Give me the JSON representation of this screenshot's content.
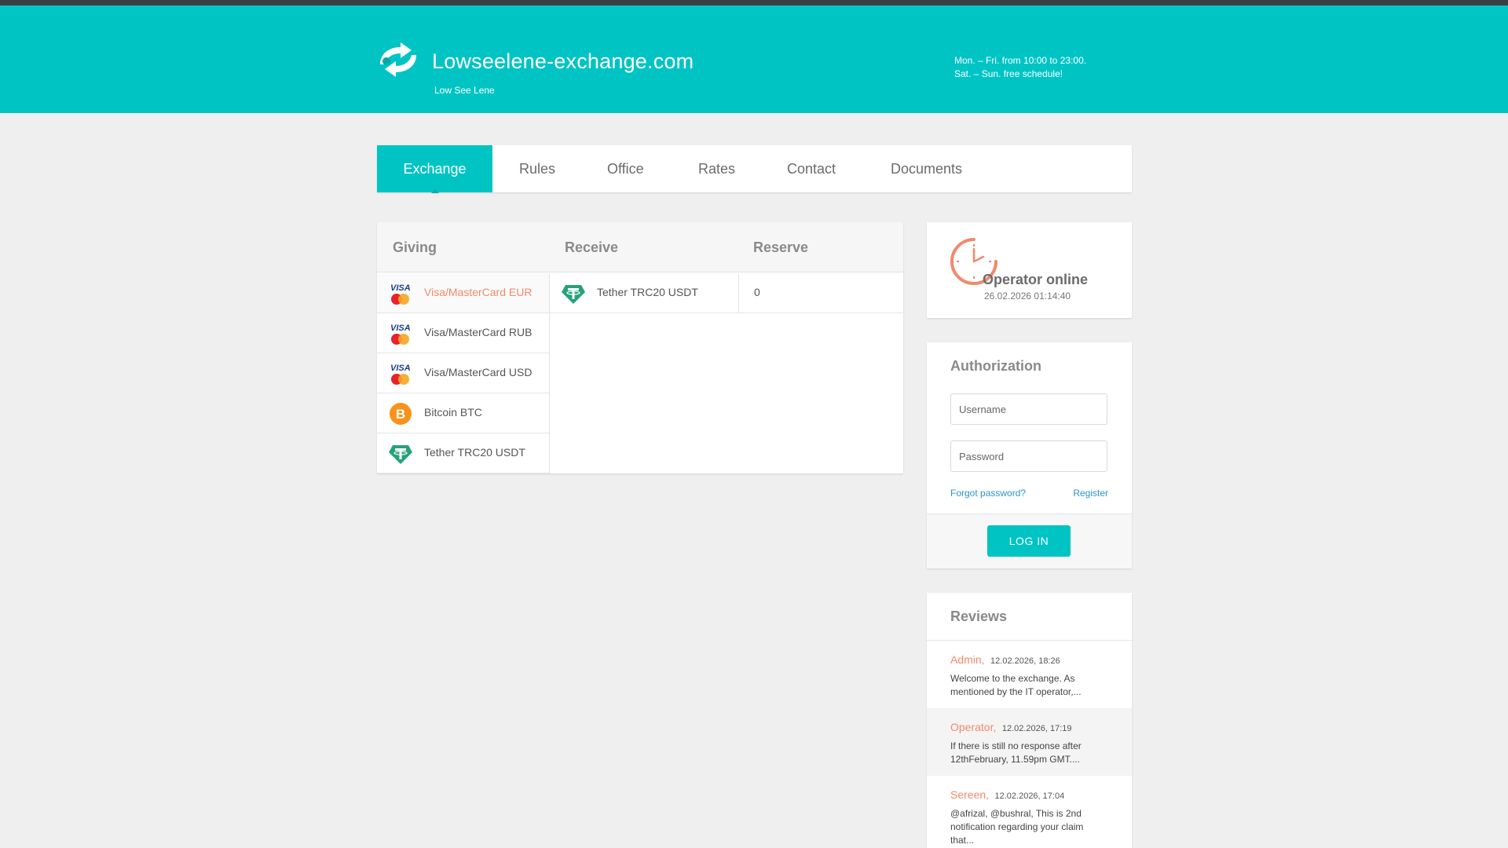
{
  "header": {
    "title": "Lowseelene-exchange.com",
    "subtitle": "Low See Lene",
    "hours_line1": "Mon. – Fri. from 10:00 to 23:00.",
    "hours_line2": "Sat. – Sun. free schedule!"
  },
  "nav": {
    "items": [
      {
        "label": "Exchange",
        "active": true
      },
      {
        "label": "Rules"
      },
      {
        "label": "Office"
      },
      {
        "label": "Rates"
      },
      {
        "label": "Contact"
      },
      {
        "label": "Documents"
      }
    ]
  },
  "exchange": {
    "headers": {
      "giving": "Giving",
      "receive": "Receive",
      "reserve": "Reserve"
    },
    "giving": [
      {
        "name": "Visa/MasterCard EUR",
        "icon": "visa-mastercard-icon",
        "selected": true
      },
      {
        "name": "Visa/MasterCard RUB",
        "icon": "visa-mastercard-icon"
      },
      {
        "name": "Visa/MasterCard USD",
        "icon": "visa-mastercard-icon"
      },
      {
        "name": "Bitcoin BTC",
        "icon": "bitcoin-icon"
      },
      {
        "name": "Tether TRC20 USDT",
        "icon": "tether-icon"
      }
    ],
    "receive": [
      {
        "name": "Tether TRC20 USDT",
        "icon": "tether-icon",
        "reserve": "0"
      }
    ]
  },
  "operator": {
    "status": "Operator online",
    "datetime": "26.02.2026 01:14:40"
  },
  "auth": {
    "title": "Authorization",
    "username_placeholder": "Username",
    "password_placeholder": "Password",
    "forgot": "Forgot password?",
    "register": "Register",
    "login": "LOG IN"
  },
  "reviews": {
    "title": "Reviews",
    "items": [
      {
        "author": "Admin,",
        "date": "12.02.2026, 18:26",
        "text": "Welcome to the exchange. As mentioned by the IT operator,..."
      },
      {
        "author": "Operator,",
        "date": "12.02.2026, 17:19",
        "text": "If there is still no response after 12thFebruary, 11.59pm GMT...."
      },
      {
        "author": "Sereen,",
        "date": "12.02.2026, 17:04",
        "text": "@afrizal, @bushral, This is 2nd notification regarding your claim that..."
      }
    ]
  },
  "colors": {
    "brand": "#00c4c4",
    "accent": "#f08a6c",
    "link": "#2b95c8",
    "topbar": "#3a3f42"
  }
}
